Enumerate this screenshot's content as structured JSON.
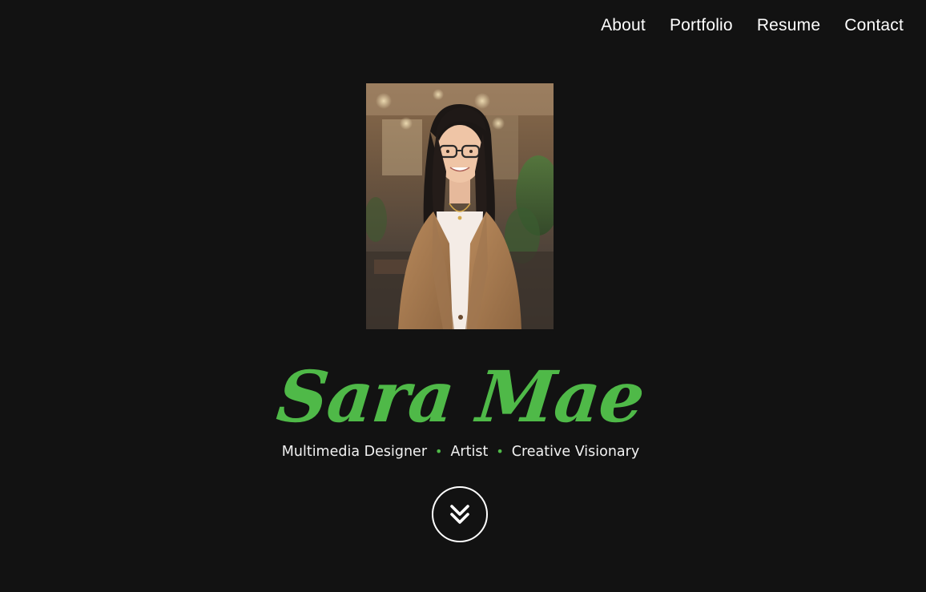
{
  "nav": {
    "items": [
      {
        "label": "About"
      },
      {
        "label": "Portfolio"
      },
      {
        "label": "Resume"
      },
      {
        "label": "Contact"
      }
    ]
  },
  "hero": {
    "portrait_icon": "profile-photo",
    "logo": {
      "name": "Sara Mae",
      "tagline": {
        "parts": [
          "Multimedia Designer",
          "Artist",
          "Creative Visionary"
        ],
        "separator": "•"
      }
    },
    "scroll_icon": "double-chevron-down-icon"
  },
  "colors": {
    "background": "#121212",
    "accent": "#4fb948",
    "text": "#ffffff"
  }
}
